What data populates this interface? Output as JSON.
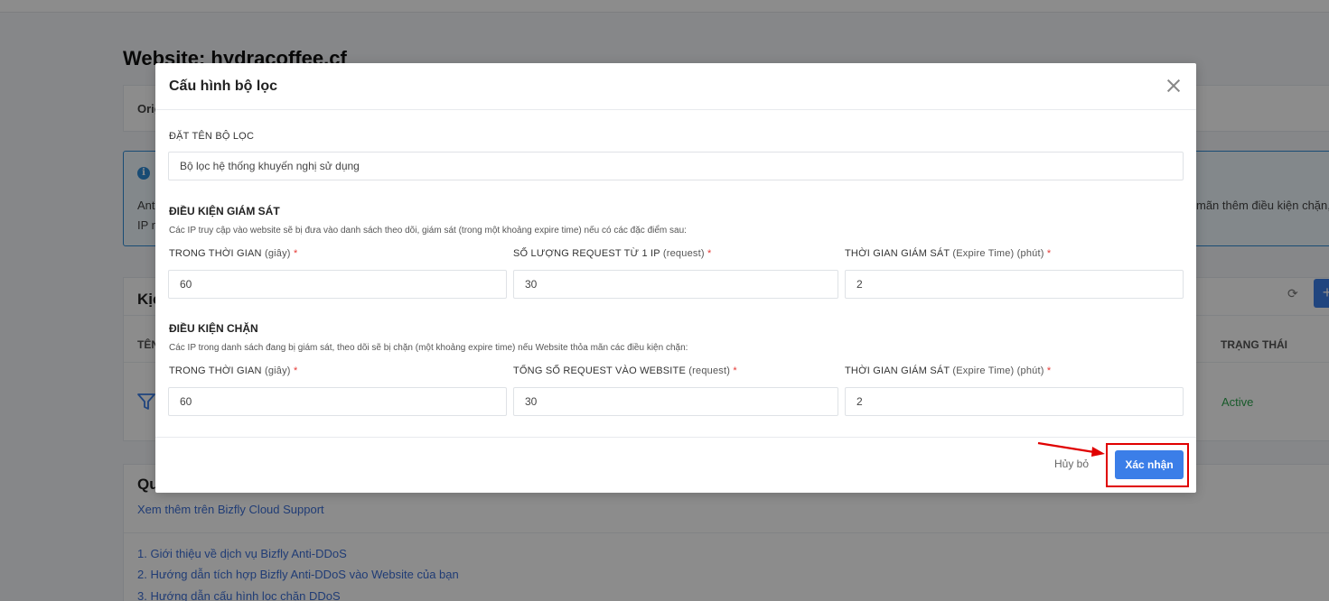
{
  "page": {
    "title": "Website: hydracoffee.cf",
    "origin_label": "Orig",
    "info": {
      "line1": "Anti",
      "line2": "IP n",
      "line_right": "mãn thêm điều kiện chặn,"
    },
    "filters_card": {
      "heading": "Kịc",
      "col_name": "TÊN",
      "col_status": "TRẠNG THÁI",
      "row_status": "Active",
      "refresh_icon_glyph": "⟳",
      "add_glyph": "+"
    },
    "guide": {
      "heading": "Qu",
      "support_link": "Xem thêm trên Bizfly Cloud Support",
      "links": [
        "1. Giới thiệu về dịch vụ Bizfly Anti-DDoS",
        "2. Hướng dẫn tích hợp Bizfly Anti-DDoS vào Website của bạn",
        "3. Hướng dẫn cấu hình lọc chặn DDoS"
      ]
    }
  },
  "modal": {
    "title": "Cấu hình bộ lọc",
    "name_label": "ĐẶT TÊN BỘ LỌC",
    "name_value": "Bộ lọc hệ thống khuyến nghị sử dụng",
    "monitor": {
      "title": "ĐIỀU KIỆN GIÁM SÁT",
      "desc": "Các IP truy cập vào website sẽ bị đưa vào danh sách theo dõi, giám sát (trong một khoảng expire time) nếu có các đặc điểm sau:",
      "f1_label": "TRONG THỜI GIAN",
      "f1_unit": "(giây)",
      "f1_value": "60",
      "f2_label": "SỐ LƯỢNG REQUEST TỪ 1 IP",
      "f2_unit": "(request)",
      "f2_value": "30",
      "f3_label": "THỜI GIAN GIÁM SÁT",
      "f3_unit": "(Expire Time) (phút)",
      "f3_value": "2"
    },
    "block": {
      "title": "ĐIỀU KIỆN CHẶN",
      "desc": "Các IP trong danh sách đang bị giám sát, theo dõi sẽ bị chặn (một khoảng expire time) nếu Website thỏa mãn các điều kiện chặn:",
      "f1_label": "TRONG THỜI GIAN",
      "f1_unit": "(giây)",
      "f1_value": "60",
      "f2_label": "TỔNG SỐ REQUEST VÀO WEBSITE",
      "f2_unit": "(request)",
      "f2_value": "30",
      "f3_label": "THỜI GIAN GIÁM SÁT",
      "f3_unit": "(Expire Time) (phút)",
      "f3_value": "2"
    },
    "required_mark": "*",
    "cancel_label": "Hủy bỏ",
    "confirm_label": "Xác nhận"
  },
  "colors": {
    "primary": "#3b7ee8",
    "required": "#e53935",
    "annotation": "#e00000",
    "active": "#2da44e"
  },
  "icons": [
    "close-icon",
    "info-icon",
    "refresh-icon",
    "add-icon",
    "filter-icon",
    "arrow-annotation"
  ]
}
